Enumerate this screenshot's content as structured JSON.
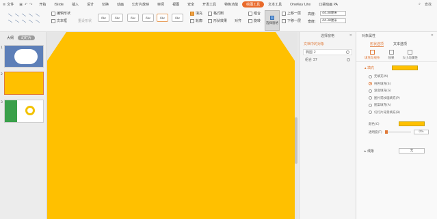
{
  "menubar": {
    "file": "文件",
    "tabs": [
      {
        "label": "开始",
        "active": false
      },
      {
        "label": "iSlide",
        "active": false
      },
      {
        "label": "插入",
        "active": false
      },
      {
        "label": "设计",
        "active": false
      },
      {
        "label": "切换",
        "active": false
      },
      {
        "label": "动画",
        "active": false
      },
      {
        "label": "幻灯片放映",
        "active": false
      },
      {
        "label": "审阅",
        "active": false
      },
      {
        "label": "视图",
        "active": false
      },
      {
        "label": "安全",
        "active": false
      },
      {
        "label": "开发工具",
        "active": false
      },
      {
        "label": "特色功能",
        "active": false
      },
      {
        "label": "绘图工具",
        "active": true
      },
      {
        "label": "文本工具",
        "active": false
      },
      {
        "label": "OneKey Lite",
        "active": false
      },
      {
        "label": "口袋动画 PA",
        "active": false
      }
    ],
    "search": "查找"
  },
  "ribbon": {
    "shape_fill_label": "编辑形状",
    "textbox_label": "文本框",
    "reset_label": "重设形状",
    "style_label": "Abc",
    "fill_label": "填充",
    "outline_label": "轮廓",
    "format_brush_label": "格式刷",
    "shape_effect_label": "形状效果",
    "align_label": "对齐",
    "group_label": "组合",
    "rotate_label": "旋转",
    "selection_pane_label": "选择窗格",
    "bring_forward_label": "上移一层",
    "send_backward_label": "下移一层",
    "height_label": "高度:",
    "height_value": "44.38厘米",
    "width_label": "宽度:",
    "width_value": "44.38厘米"
  },
  "leftpanel": {
    "tab_outline": "大纲",
    "tab_slides": "幻灯片",
    "slide_numbers": [
      "1",
      "2",
      "3"
    ]
  },
  "selection_pane": {
    "title": "选择窗格",
    "subtitle": "文档中的对象",
    "objects": [
      {
        "name": "椭圆 2",
        "selected": true
      },
      {
        "name": "组合 37",
        "selected": false
      }
    ]
  },
  "property_pane": {
    "title": "对象属性",
    "tabs": [
      "形状选项",
      "文本选项"
    ],
    "subtabs": [
      "填充与线条",
      "效果",
      "大小与属性"
    ],
    "fill_section": "填充",
    "fill_color": "#ffc000",
    "fill_options": [
      {
        "label": "无填充(N)",
        "checked": false
      },
      {
        "label": "纯色填充(S)",
        "checked": true
      },
      {
        "label": "渐变填充(G)",
        "checked": false
      },
      {
        "label": "图片或纹理填充(P)",
        "checked": false
      },
      {
        "label": "图案填充(A)",
        "checked": false
      },
      {
        "label": "幻灯片背景填充(B)",
        "checked": false
      }
    ],
    "color_label": "颜色(C)",
    "transparency_label": "透明度(T)",
    "transparency_value": "0%",
    "line_section": "线条",
    "line_value": "无"
  },
  "colors": {
    "accent": "#e96a2b",
    "shape_fill": "#ffc000"
  }
}
